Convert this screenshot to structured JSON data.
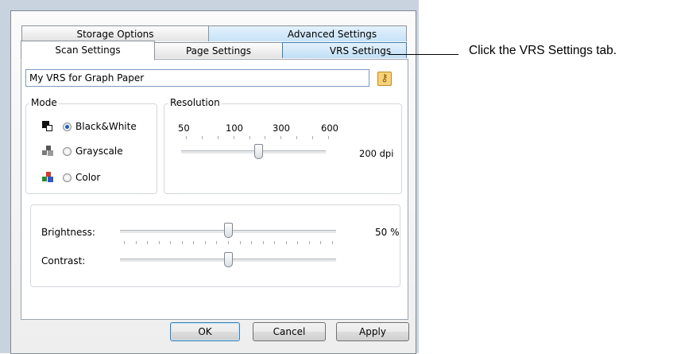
{
  "tabs": {
    "row_back": [
      {
        "label": "Storage Options"
      },
      {
        "label": "Advanced Settings"
      }
    ],
    "row_front": [
      {
        "label": "Scan Settings"
      },
      {
        "label": "Page Settings"
      },
      {
        "label": "VRS Settings"
      }
    ]
  },
  "profile_name": "My VRS for Graph Paper",
  "mode": {
    "legend": "Mode",
    "options": [
      {
        "label": "Black&White",
        "checked": true,
        "icon": "bw-mode-icon"
      },
      {
        "label": "Grayscale",
        "checked": false,
        "icon": "grayscale-mode-icon"
      },
      {
        "label": "Color",
        "checked": false,
        "icon": "color-mode-icon"
      }
    ]
  },
  "resolution": {
    "legend": "Resolution",
    "tick_labels": [
      "50",
      "100",
      "300",
      "600"
    ],
    "value_label": "200 dpi"
  },
  "brightness": {
    "label": "Brightness:",
    "value_label": "50 %",
    "value_fraction": 0.5
  },
  "contrast": {
    "label": "Contrast:",
    "value_fraction": 0.5
  },
  "buttons": {
    "ok": "OK",
    "cancel": "Cancel",
    "apply": "Apply"
  },
  "callout": "Click the VRS Settings tab.",
  "colors": {
    "tab_hover": "#bfdef5",
    "radio_dot": "#1e5fb3",
    "dialog_frame": "#c9d3df"
  }
}
